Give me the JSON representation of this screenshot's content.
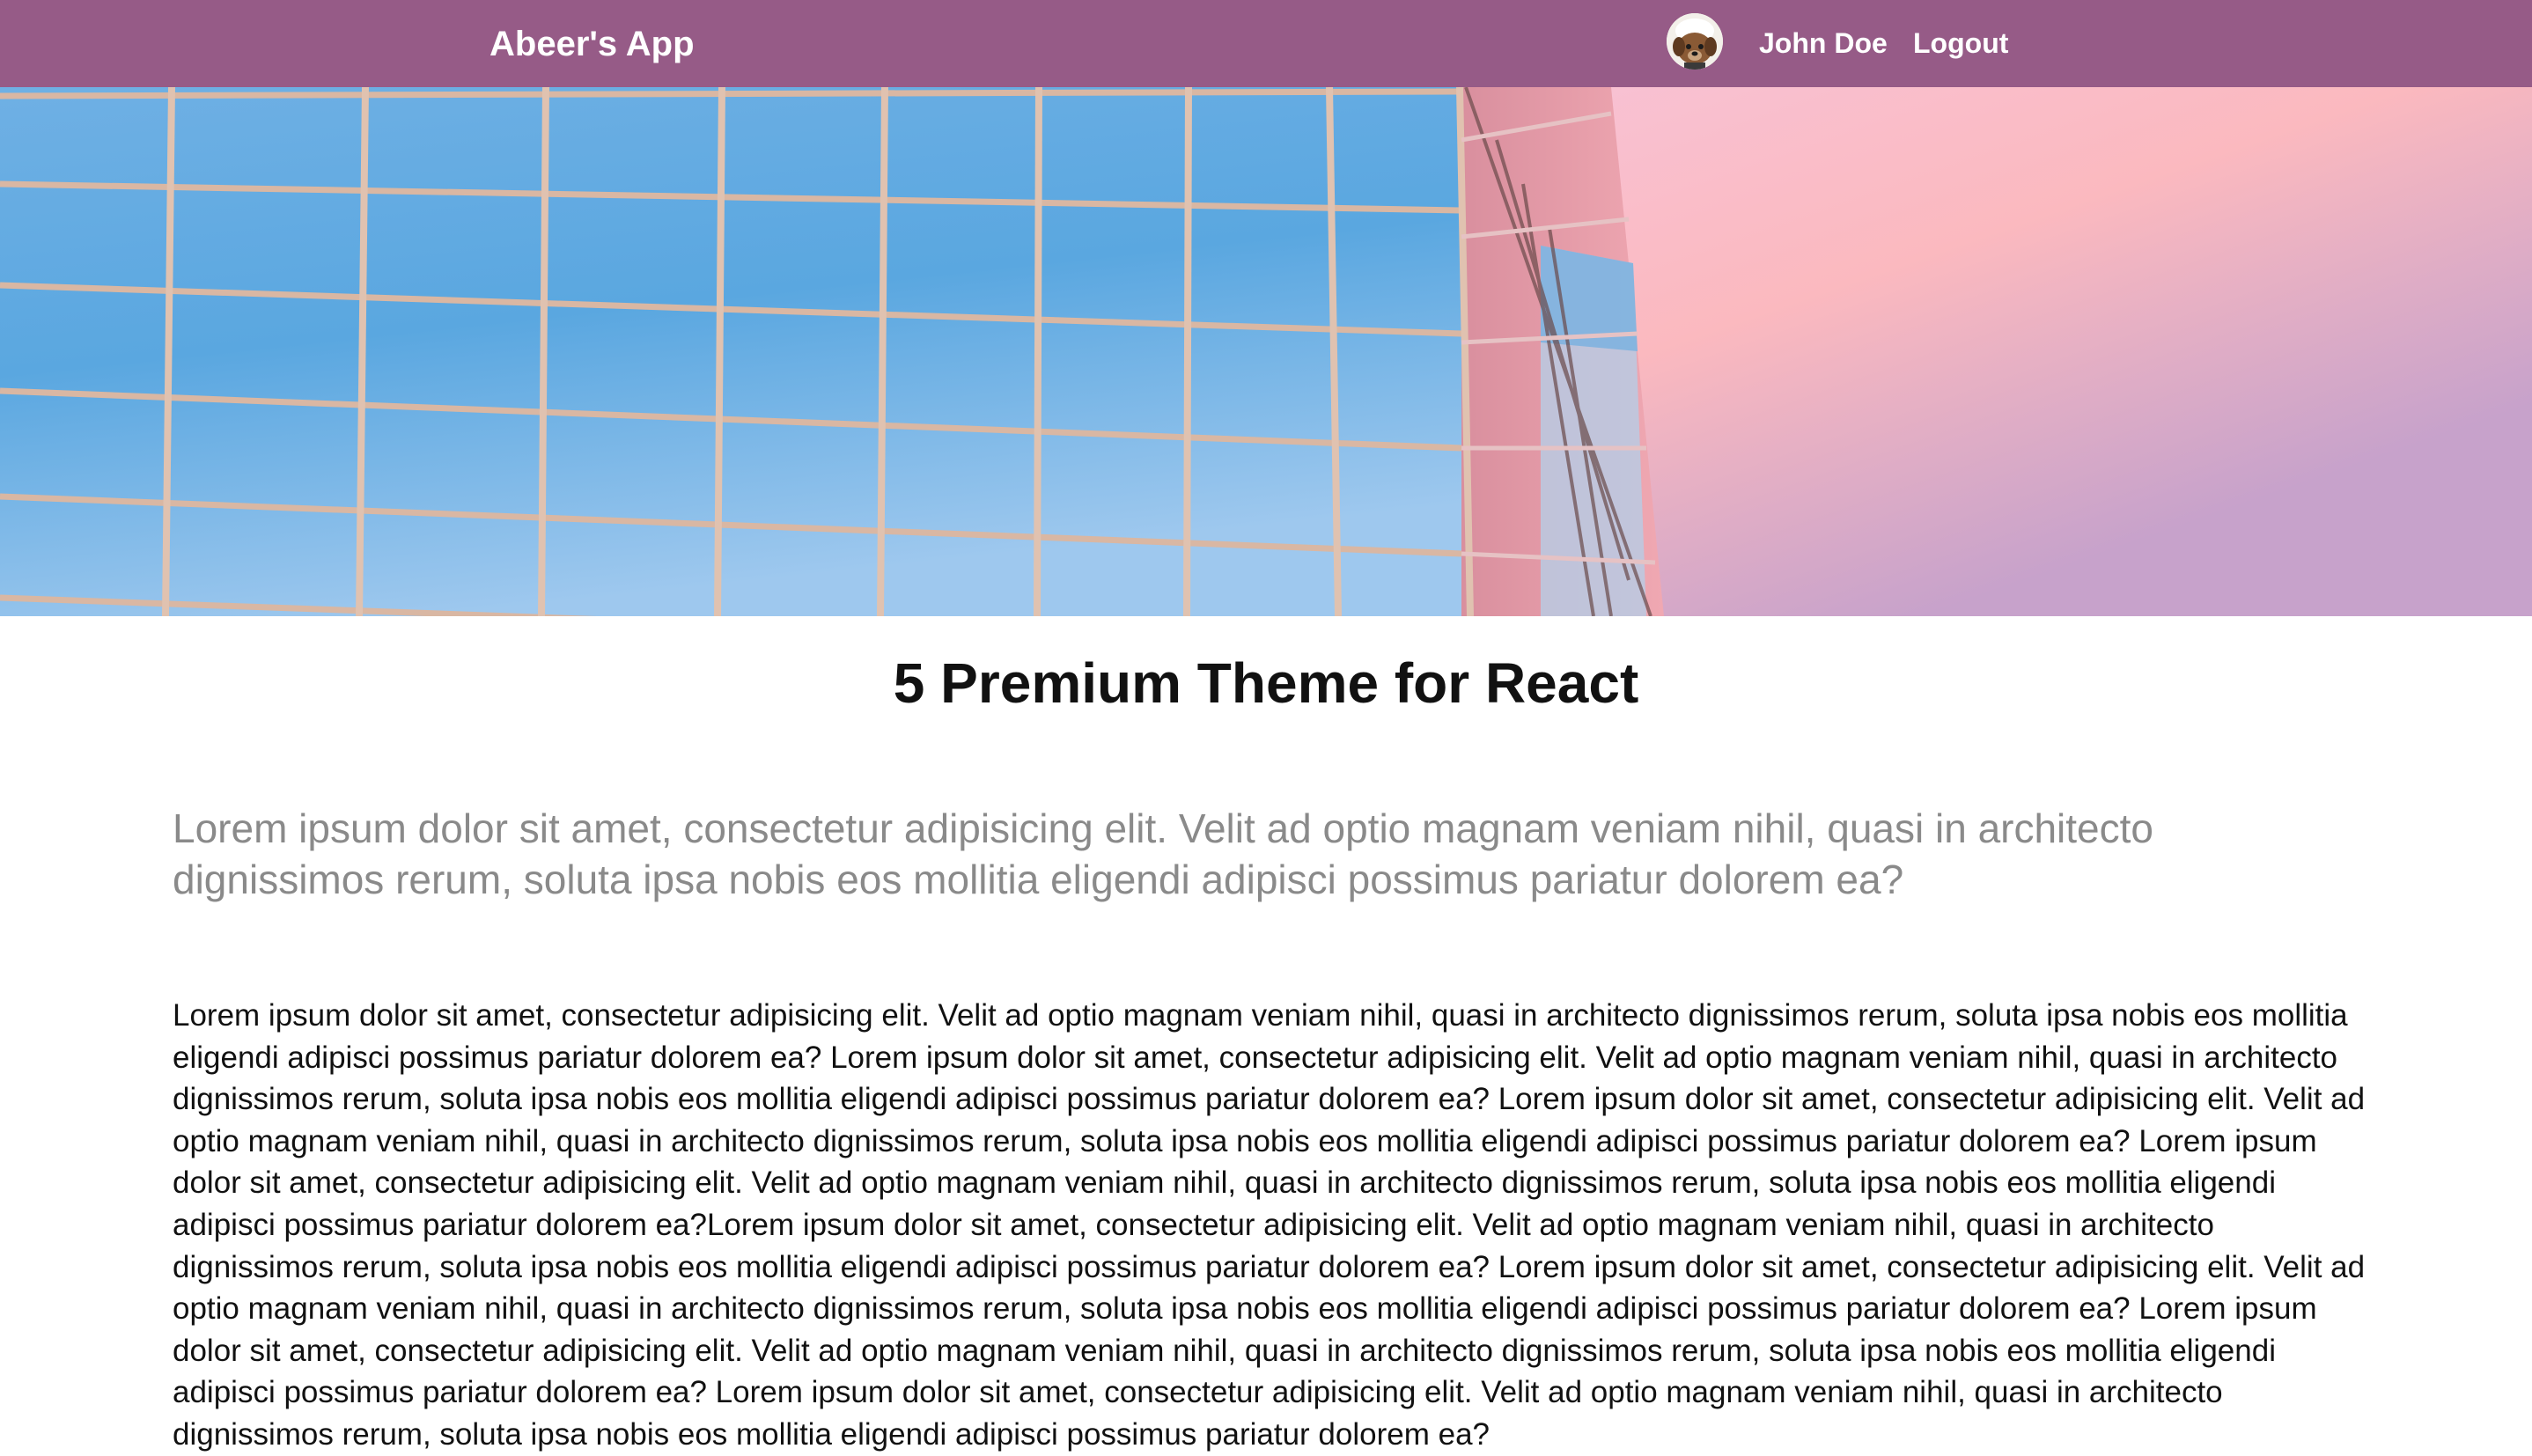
{
  "navbar": {
    "brand": "Abeer's App",
    "user_name": "John Doe",
    "logout_label": "Logout",
    "background_color": "#965b87",
    "avatar_icon": "user-avatar-icon"
  },
  "hero": {
    "image_description_icon": "glass-building-photo"
  },
  "main": {
    "title": "5 Premium Theme for React",
    "lead": "Lorem ipsum dolor sit amet, consectetur adipisicing elit. Velit ad optio magnam veniam nihil, quasi in architecto dignissimos rerum, soluta ipsa nobis eos mollitia eligendi adipisci possimus pariatur dolorem ea?",
    "body": "Lorem ipsum dolor sit amet, consectetur adipisicing elit. Velit ad optio magnam veniam nihil, quasi in architecto dignissimos rerum, soluta ipsa nobis eos mollitia eligendi adipisci possimus pariatur dolorem ea? Lorem ipsum dolor sit amet, consectetur adipisicing elit. Velit ad optio magnam veniam nihil, quasi in architecto dignissimos rerum, soluta ipsa nobis eos mollitia eligendi adipisci possimus pariatur dolorem ea? Lorem ipsum dolor sit amet, consectetur adipisicing elit. Velit ad optio magnam veniam nihil, quasi in architecto dignissimos rerum, soluta ipsa nobis eos mollitia eligendi adipisci possimus pariatur dolorem ea? Lorem ipsum dolor sit amet, consectetur adipisicing elit. Velit ad optio magnam veniam nihil, quasi in architecto dignissimos rerum, soluta ipsa nobis eos mollitia eligendi adipisci possimus pariatur dolorem ea?Lorem ipsum dolor sit amet, consectetur adipisicing elit. Velit ad optio magnam veniam nihil, quasi in architecto dignissimos rerum, soluta ipsa nobis eos mollitia eligendi adipisci possimus pariatur dolorem ea? Lorem ipsum dolor sit amet, consectetur adipisicing elit. Velit ad optio magnam veniam nihil, quasi in architecto dignissimos rerum, soluta ipsa nobis eos mollitia eligendi adipisci possimus pariatur dolorem ea? Lorem ipsum dolor sit amet, consectetur adipisicing elit. Velit ad optio magnam veniam nihil, quasi in architecto dignissimos rerum, soluta ipsa nobis eos mollitia eligendi adipisci possimus pariatur dolorem ea? Lorem ipsum dolor sit amet, consectetur adipisicing elit. Velit ad optio magnam veniam nihil, quasi in architecto dignissimos rerum, soluta ipsa nobis eos mollitia eligendi adipisci possimus pariatur dolorem ea?"
  }
}
